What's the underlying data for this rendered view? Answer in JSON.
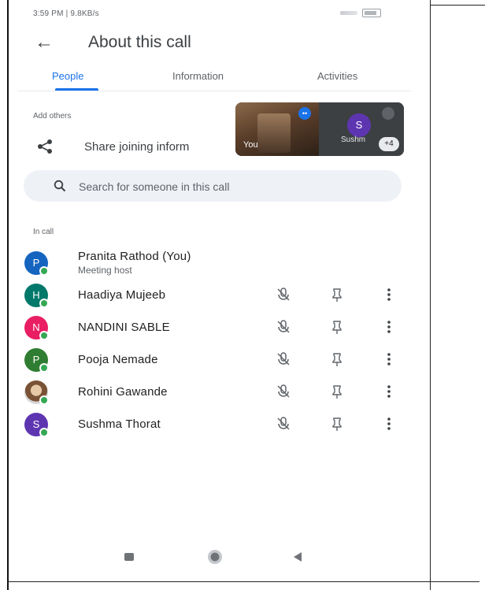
{
  "status_bar": {
    "left_text": "3:59 PM | 9.8KB/s"
  },
  "app_bar": {
    "title": "About this call"
  },
  "tabs": [
    {
      "label": "People",
      "active": true
    },
    {
      "label": "Information",
      "active": false
    },
    {
      "label": "Activities",
      "active": false
    }
  ],
  "add_others": {
    "label": "Add others",
    "share_label": "Share joining inform"
  },
  "video_tiles": {
    "self_label": "You",
    "other_label": "Sushm",
    "other_initial": "S",
    "overflow_count": "+4"
  },
  "search": {
    "placeholder": "Search for someone in this call"
  },
  "in_call": {
    "label": "In call",
    "participants": [
      {
        "initial": "P",
        "name": "Pranita Rathod (You)",
        "role": "Meeting host",
        "color": "#1565c0"
      },
      {
        "initial": "H",
        "name": "Haadiya Mujeeb",
        "color": "#00796b"
      },
      {
        "initial": "N",
        "name": "NANDINI SABLE",
        "color": "#e91e63"
      },
      {
        "initial": "P",
        "name": "Pooja Nemade",
        "color": "#2e7d32"
      },
      {
        "initial": "",
        "name": "Rohini Gawande",
        "color": "#d6d6d6"
      },
      {
        "initial": "S",
        "name": "Sushma Thorat",
        "color": "#5e35b1"
      }
    ]
  },
  "colors": {
    "accent": "#1a73e8",
    "online_dot": "#34a853"
  }
}
